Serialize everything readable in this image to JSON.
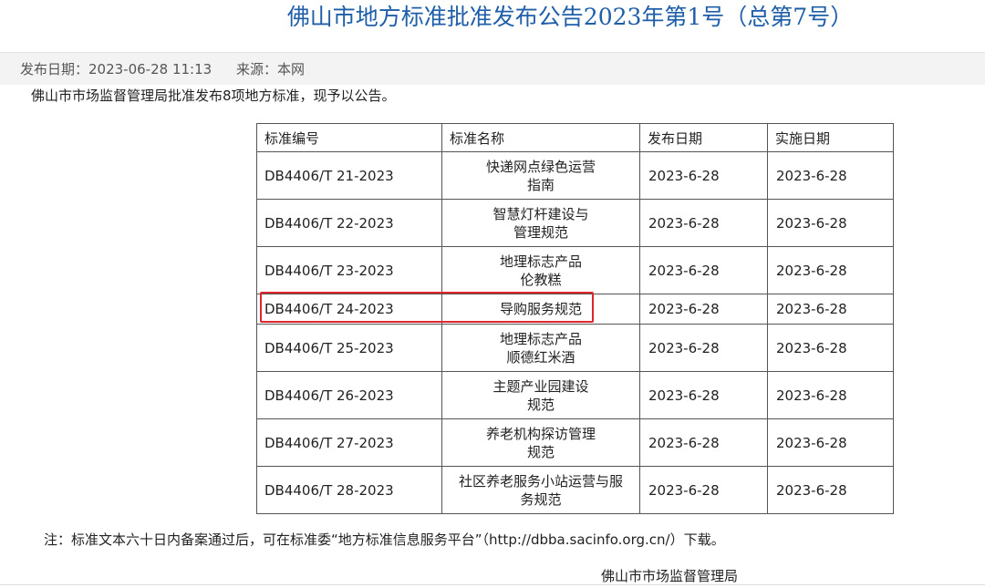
{
  "title": "佛山市地方标准批准发布公告2023年第1号（总第7号）",
  "meta": {
    "publish_date": "发布日期：2023-06-28 11:13",
    "source": "来源：本网"
  },
  "intro": "佛山市市场监督管理局批准发布8项地方标准，现予以公告。",
  "table": {
    "headers": [
      "标准编号",
      "标准名称",
      "发布日期",
      "实施日期"
    ],
    "rows": [
      {
        "code": "DB4406/T 21-2023",
        "name_lines": [
          "快递网点绿色运营",
          "指南"
        ],
        "publish": "2023-6-28",
        "effective": "2023-6-28"
      },
      {
        "code": "DB4406/T 22-2023",
        "name_lines": [
          "智慧灯杆建设与",
          "管理规范"
        ],
        "publish": "2023-6-28",
        "effective": "2023-6-28"
      },
      {
        "code": "DB4406/T 23-2023",
        "name_lines": [
          "地理标志产品",
          "伦教糕"
        ],
        "publish": "2023-6-28",
        "effective": "2023-6-28"
      },
      {
        "code": "DB4406/T 24-2023",
        "name_lines": [
          "导购服务规范",
          ""
        ],
        "publish": "2023-6-28",
        "effective": "2023-6-28"
      },
      {
        "code": "DB4406/T 25-2023",
        "name_lines": [
          "地理标志产品",
          "顺德红米酒"
        ],
        "publish": "2023-6-28",
        "effective": "2023-6-28"
      },
      {
        "code": "DB4406/T 26-2023",
        "name_lines": [
          "主题产业园建设",
          "规范"
        ],
        "publish": "2023-6-28",
        "effective": "2023-6-28"
      },
      {
        "code": "DB4406/T 27-2023",
        "name_lines": [
          "养老机构探访管理",
          "规范"
        ],
        "publish": "2023-6-28",
        "effective": "2023-6-28"
      },
      {
        "code": "DB4406/T 28-2023",
        "name_lines": [
          "社区养老服务小站运营与服",
          "务规范"
        ],
        "publish": "2023-6-28",
        "effective": "2023-6-28"
      }
    ]
  },
  "note": "注：标准文本六十日内备案通过后，可在标准委“地方标准信息服务平台”（http://dbba.sacinfo.org.cn/）下载。",
  "signature": "佛山市市场监督管理局",
  "colors": {
    "title": "#1f5ea8",
    "highlight": "#e0262c"
  }
}
